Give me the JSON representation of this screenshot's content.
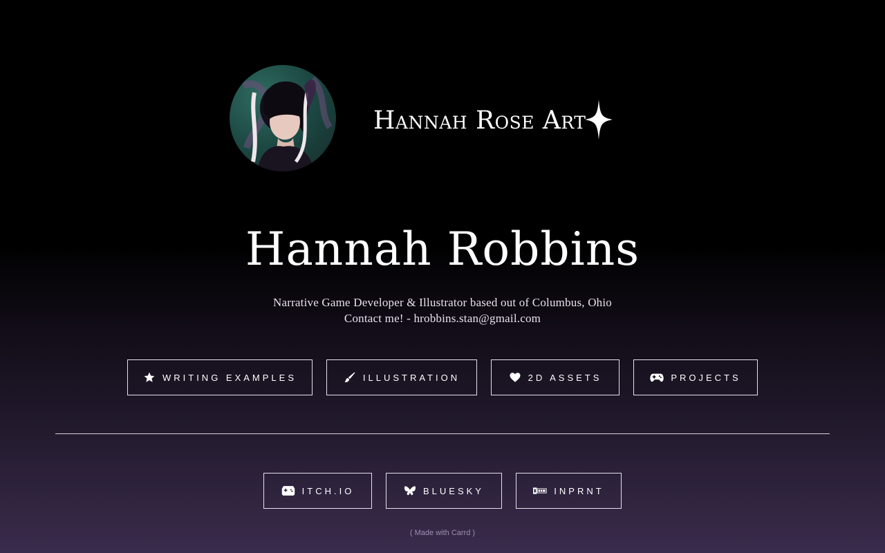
{
  "header": {
    "brand": "Hannah Rose Art"
  },
  "profile": {
    "name": "Hannah Robbins",
    "tagline_line1": "Narrative Game Developer & Illustrator based out of Columbus, Ohio",
    "tagline_line2": "Contact me! - hrobbins.stan@gmail.com"
  },
  "nav_buttons": [
    {
      "label": "WRITING EXAMPLES",
      "icon": "star-icon"
    },
    {
      "label": "ILLUSTRATION",
      "icon": "paintbrush-icon"
    },
    {
      "label": "2D ASSETS",
      "icon": "heart-icon"
    },
    {
      "label": "PROJECTS",
      "icon": "gamepad-icon"
    }
  ],
  "social_buttons": [
    {
      "label": "ITCH.IO",
      "icon": "itchio-icon"
    },
    {
      "label": "BLUESKY",
      "icon": "butterfly-icon"
    },
    {
      "label": "INPRNT",
      "icon": "inprnt-icon"
    }
  ],
  "footer": {
    "made_with": "( Made with Carrd )"
  },
  "colors": {
    "background_top": "#000000",
    "background_bottom": "#3a2c4c",
    "text": "#ffffff",
    "button_border": "#e8e2ee",
    "footer_text": "#9c8fb0"
  }
}
